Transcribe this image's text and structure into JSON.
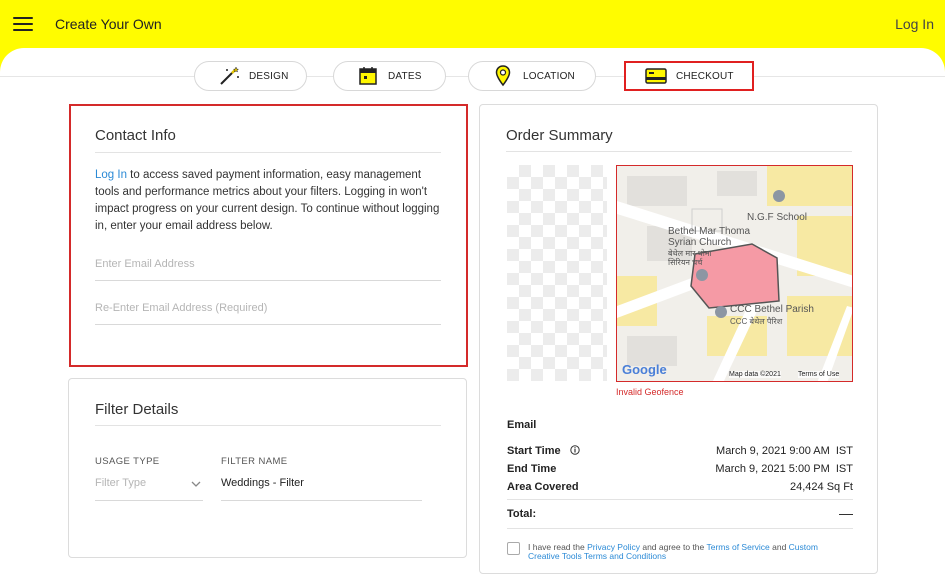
{
  "header": {
    "title": "Create Your Own",
    "login_label": "Log In"
  },
  "tabs": [
    {
      "label": "DESIGN",
      "icon": "magic-wand-icon"
    },
    {
      "label": "DATES",
      "icon": "calendar-icon"
    },
    {
      "label": "LOCATION",
      "icon": "map-pin-icon"
    },
    {
      "label": "CHECKOUT",
      "icon": "credit-card-icon",
      "active": true
    }
  ],
  "contact": {
    "title": "Contact Info",
    "login_link": "Log In",
    "description": " to access saved payment information, easy management tools and performance metrics about your filters. Logging in won't impact progress on your current design. To continue without logging in, enter your email address below.",
    "email_placeholder": "Enter Email Address",
    "email_confirm_placeholder": "Re-Enter Email Address (Required)"
  },
  "filter_details": {
    "title": "Filter Details",
    "usage_type_label": "USAGE TYPE",
    "usage_type_placeholder": "Filter Type",
    "filter_name_label": "FILTER NAME",
    "filter_name_value": "Weddings - Filter"
  },
  "order_summary": {
    "title": "Order Summary",
    "map": {
      "labels": [
        "N.G.F School",
        "Bethel Mar Thoma",
        "Syrian Church",
        "बेथेल मार थोमा",
        "सिरियन चर्च",
        "CCC Bethel Parish",
        "CCC बेथेल पैरिश"
      ],
      "attribution": "Map data ©2021",
      "terms": "Terms of Use",
      "logo": "Google"
    },
    "geofence_error": "Invalid Geofence",
    "email_label": "Email",
    "start_time_label": "Start Time",
    "start_time_value": "March 9, 2021 9:00 AM  IST",
    "end_time_label": "End Time",
    "end_time_value": "March 9, 2021 5:00 PM  IST",
    "area_label": "Area Covered",
    "area_value": "24,424 Sq Ft",
    "total_label": "Total:",
    "total_value": "—",
    "terms_prefix": "I have read the ",
    "privacy_link": "Privacy Policy",
    "terms_mid": " and agree to the ",
    "tos_link": "Terms of Service",
    "terms_and": " and ",
    "custom_link": "Custom Creative Tools Terms and Conditions"
  },
  "colors": {
    "brand_yellow": "#fffc00",
    "link_blue": "#2b8ad6",
    "highlight_red": "#d42a2a"
  }
}
